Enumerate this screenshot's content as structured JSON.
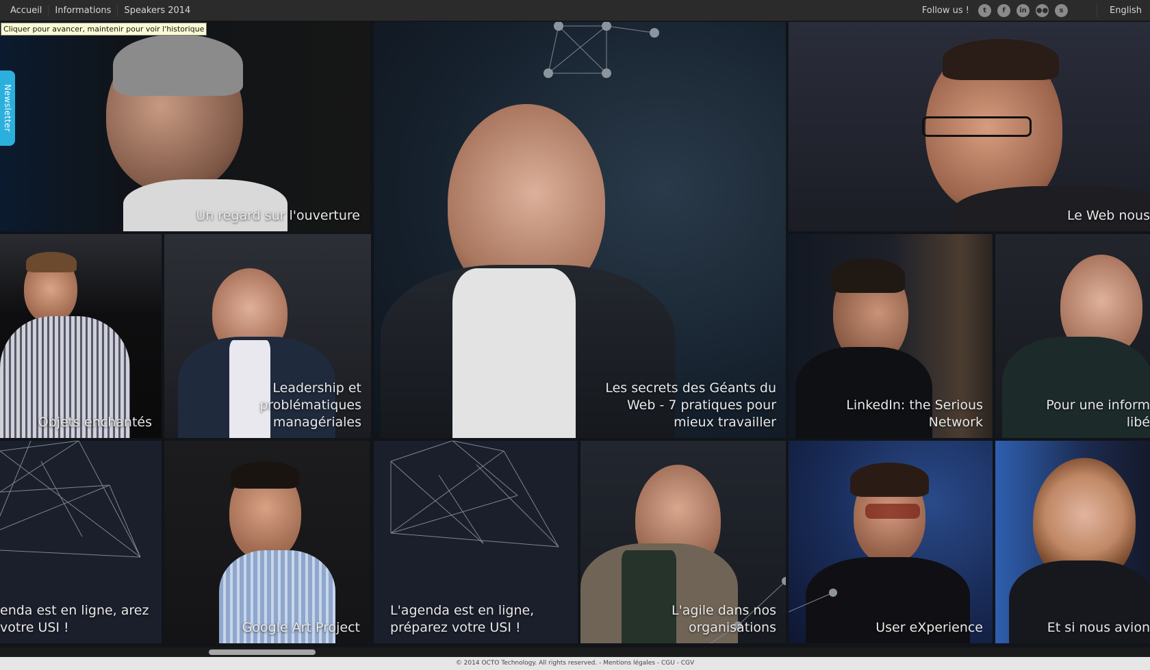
{
  "nav": {
    "items": [
      "Accueil",
      "Informations",
      "Speakers 2014"
    ]
  },
  "follow": {
    "label": "Follow us !",
    "icons": [
      "twitter-icon",
      "facebook-icon",
      "linkedin-icon",
      "flickr-icon",
      "slideshare-icon"
    ]
  },
  "language": "English",
  "tooltip": "Cliquer pour avancer, maintenir pour voir l'historique",
  "newsletter": "Newsletter",
  "tiles": {
    "t1": "Un regard sur l'ouverture",
    "t2": "Les secrets des Géants du Web - 7 pratiques pour mieux travailler",
    "t3": "Le Web nous",
    "t4": "Objets enchantés",
    "t5": "Leadership et problématiques managériales",
    "t6": "LinkedIn: the Serious Network",
    "t7": "Pour une inform libé",
    "t8": "enda est en ligne, arez votre USI !",
    "t9": "Google Art Project",
    "t10": "L'agenda est en ligne, préparez votre USI !",
    "t11": "L'agile dans nos organisations",
    "t12": "User eXperience",
    "t13": "Et si nous avion"
  },
  "footer": "© 2014 OCTO Technology. All rights reserved. - Mentions légales - CGU - CGV",
  "colors": {
    "accent": "#2bb0de",
    "tile_dark": "#1a1f2b",
    "topbar": "#2b2b2b"
  }
}
